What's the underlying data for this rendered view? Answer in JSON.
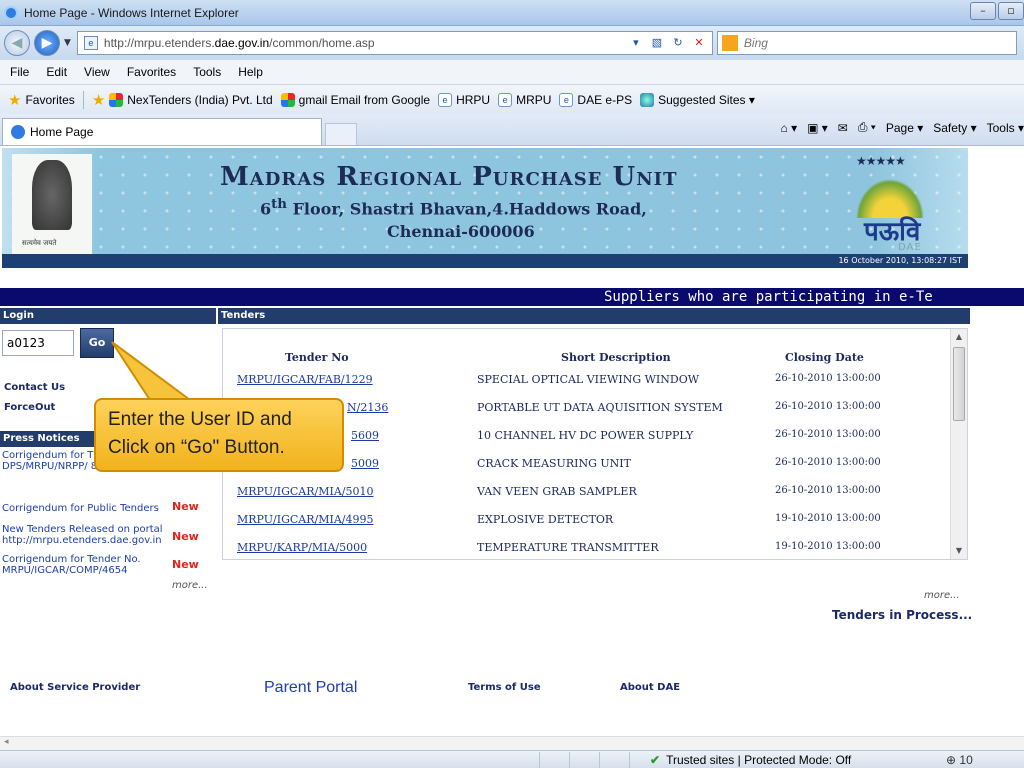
{
  "browser": {
    "title": "Home Page - Windows Internet Explorer",
    "address_prefix": "http://mrpu.etenders.",
    "address_domain": "dae.gov.in",
    "address_suffix": "/common/home.asp",
    "search_placeholder": "Bing",
    "menu": [
      "File",
      "Edit",
      "View",
      "Favorites",
      "Tools",
      "Help"
    ],
    "favorites_label": "Favorites",
    "favorites": [
      {
        "label": "NexTenders (India) Pvt. Ltd",
        "icon": "multicolor-icon"
      },
      {
        "label": "gmail Email from Google",
        "icon": "multicolor-icon"
      },
      {
        "label": "HRPU",
        "icon": "ie-page-icon"
      },
      {
        "label": "MRPU",
        "icon": "ie-page-icon"
      },
      {
        "label": "DAE e-PS",
        "icon": "ie-page-icon"
      },
      {
        "label": "Suggested Sites ▾",
        "icon": "ie-globe-icon"
      }
    ],
    "tab_title": "Home Page",
    "command_bar": {
      "page": "Page ▾",
      "safety": "Safety ▾",
      "tools": "Tools ▾"
    },
    "status": {
      "trusted": "Trusted sites | Protected Mode: Off",
      "zoom": "⊕ 10"
    }
  },
  "banner": {
    "title": "Madras Regional Purchase Unit",
    "address_line1_pre": "6",
    "address_line1_sup": "th",
    "address_line1_post": " Floor, Shastri Bhavan,4.Haddows Road,",
    "address_line2": "Chennai-600006",
    "emblem_motto": "सत्यमेव जयते",
    "logo_text": "पऊवि",
    "logo_sub": "DAE",
    "datetime": "16 October 2010,  13:08:27  IST"
  },
  "marquee": "Suppliers who are participating in e-Te",
  "login": {
    "header": "Login",
    "user_id": "a0123",
    "go_label": "Go",
    "contact_us": "Contact Us",
    "force_out": "ForceOut"
  },
  "press": {
    "header": "Press Notices",
    "items": [
      {
        "text": "Corrigendum for T DPS/MRPU/NRPP/ 868",
        "new": ""
      },
      {
        "text": "Corrigendum for Public Tenders",
        "new": "New"
      },
      {
        "text": "New Tenders Released on portal http://mrpu.etenders.dae.gov.in",
        "new": "New"
      },
      {
        "text": "Corrigendum for Tender No. MRPU/IGCAR/COMP/4654",
        "new": "New"
      }
    ],
    "more": "more..."
  },
  "tenders": {
    "header": "Tenders",
    "col_no": "Tender No",
    "col_desc": "Short Description",
    "col_date": "Closing Date",
    "rows": [
      {
        "no": "MRPU/IGCAR/FAB/1229",
        "desc": "SPECIAL OPTICAL VIEWING WINDOW",
        "date": "26-10-2010 13:00:00"
      },
      {
        "no": "N/2136",
        "desc": "PORTABLE UT DATA AQUISITION SYSTEM",
        "date": "26-10-2010 13:00:00"
      },
      {
        "no": "5609",
        "desc": "10 CHANNEL HV DC POWER SUPPLY",
        "date": "26-10-2010 13:00:00"
      },
      {
        "no": "5009",
        "desc": "CRACK MEASURING UNIT",
        "date": "26-10-2010 13:00:00"
      },
      {
        "no": "MRPU/IGCAR/MIA/5010",
        "desc": "VAN VEEN GRAB SAMPLER",
        "date": "26-10-2010 13:00:00"
      },
      {
        "no": "MRPU/IGCAR/MIA/4995",
        "desc": "EXPLOSIVE DETECTOR",
        "date": "19-10-2010 13:00:00"
      },
      {
        "no": "MRPU/KARP/MIA/5000",
        "desc": "TEMPERATURE TRANSMITTER",
        "date": "19-10-2010 13:00:00"
      }
    ],
    "more": "more...",
    "in_process": "Tenders in Process..."
  },
  "footer": {
    "about_provider": "About Service Provider",
    "parent_portal": "Parent Portal",
    "terms": "Terms of Use",
    "about_dae": "About DAE"
  },
  "callout": {
    "line1": "Enter the User ID and",
    "line2": "Click on “Go\" Button."
  },
  "colors": {
    "header_blue": "#223d6b",
    "marquee_bg": "#0a0a6e",
    "new_red": "#e0241b",
    "callout": "#f2b31c"
  }
}
